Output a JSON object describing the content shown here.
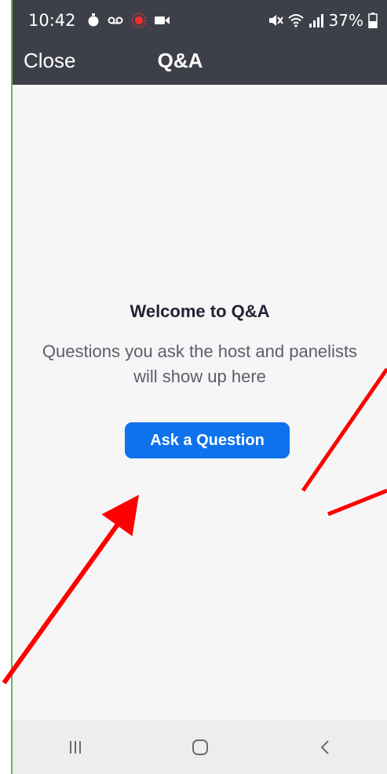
{
  "status_bar": {
    "time": "10:42",
    "battery": "37%"
  },
  "header": {
    "close_label": "Close",
    "title": "Q&A"
  },
  "main": {
    "welcome_title": "Welcome to Q&A",
    "welcome_subtitle": "Questions you ask the host and panelists will show up here",
    "ask_button_label": "Ask a Question"
  },
  "nav": {
    "icons": [
      "recent-apps-icon",
      "home-icon",
      "back-icon"
    ]
  },
  "colors": {
    "header_bg": "#3e4049",
    "content_bg": "#f6f6f7",
    "accent": "#0e72ed",
    "annotation": "#ff0000"
  }
}
